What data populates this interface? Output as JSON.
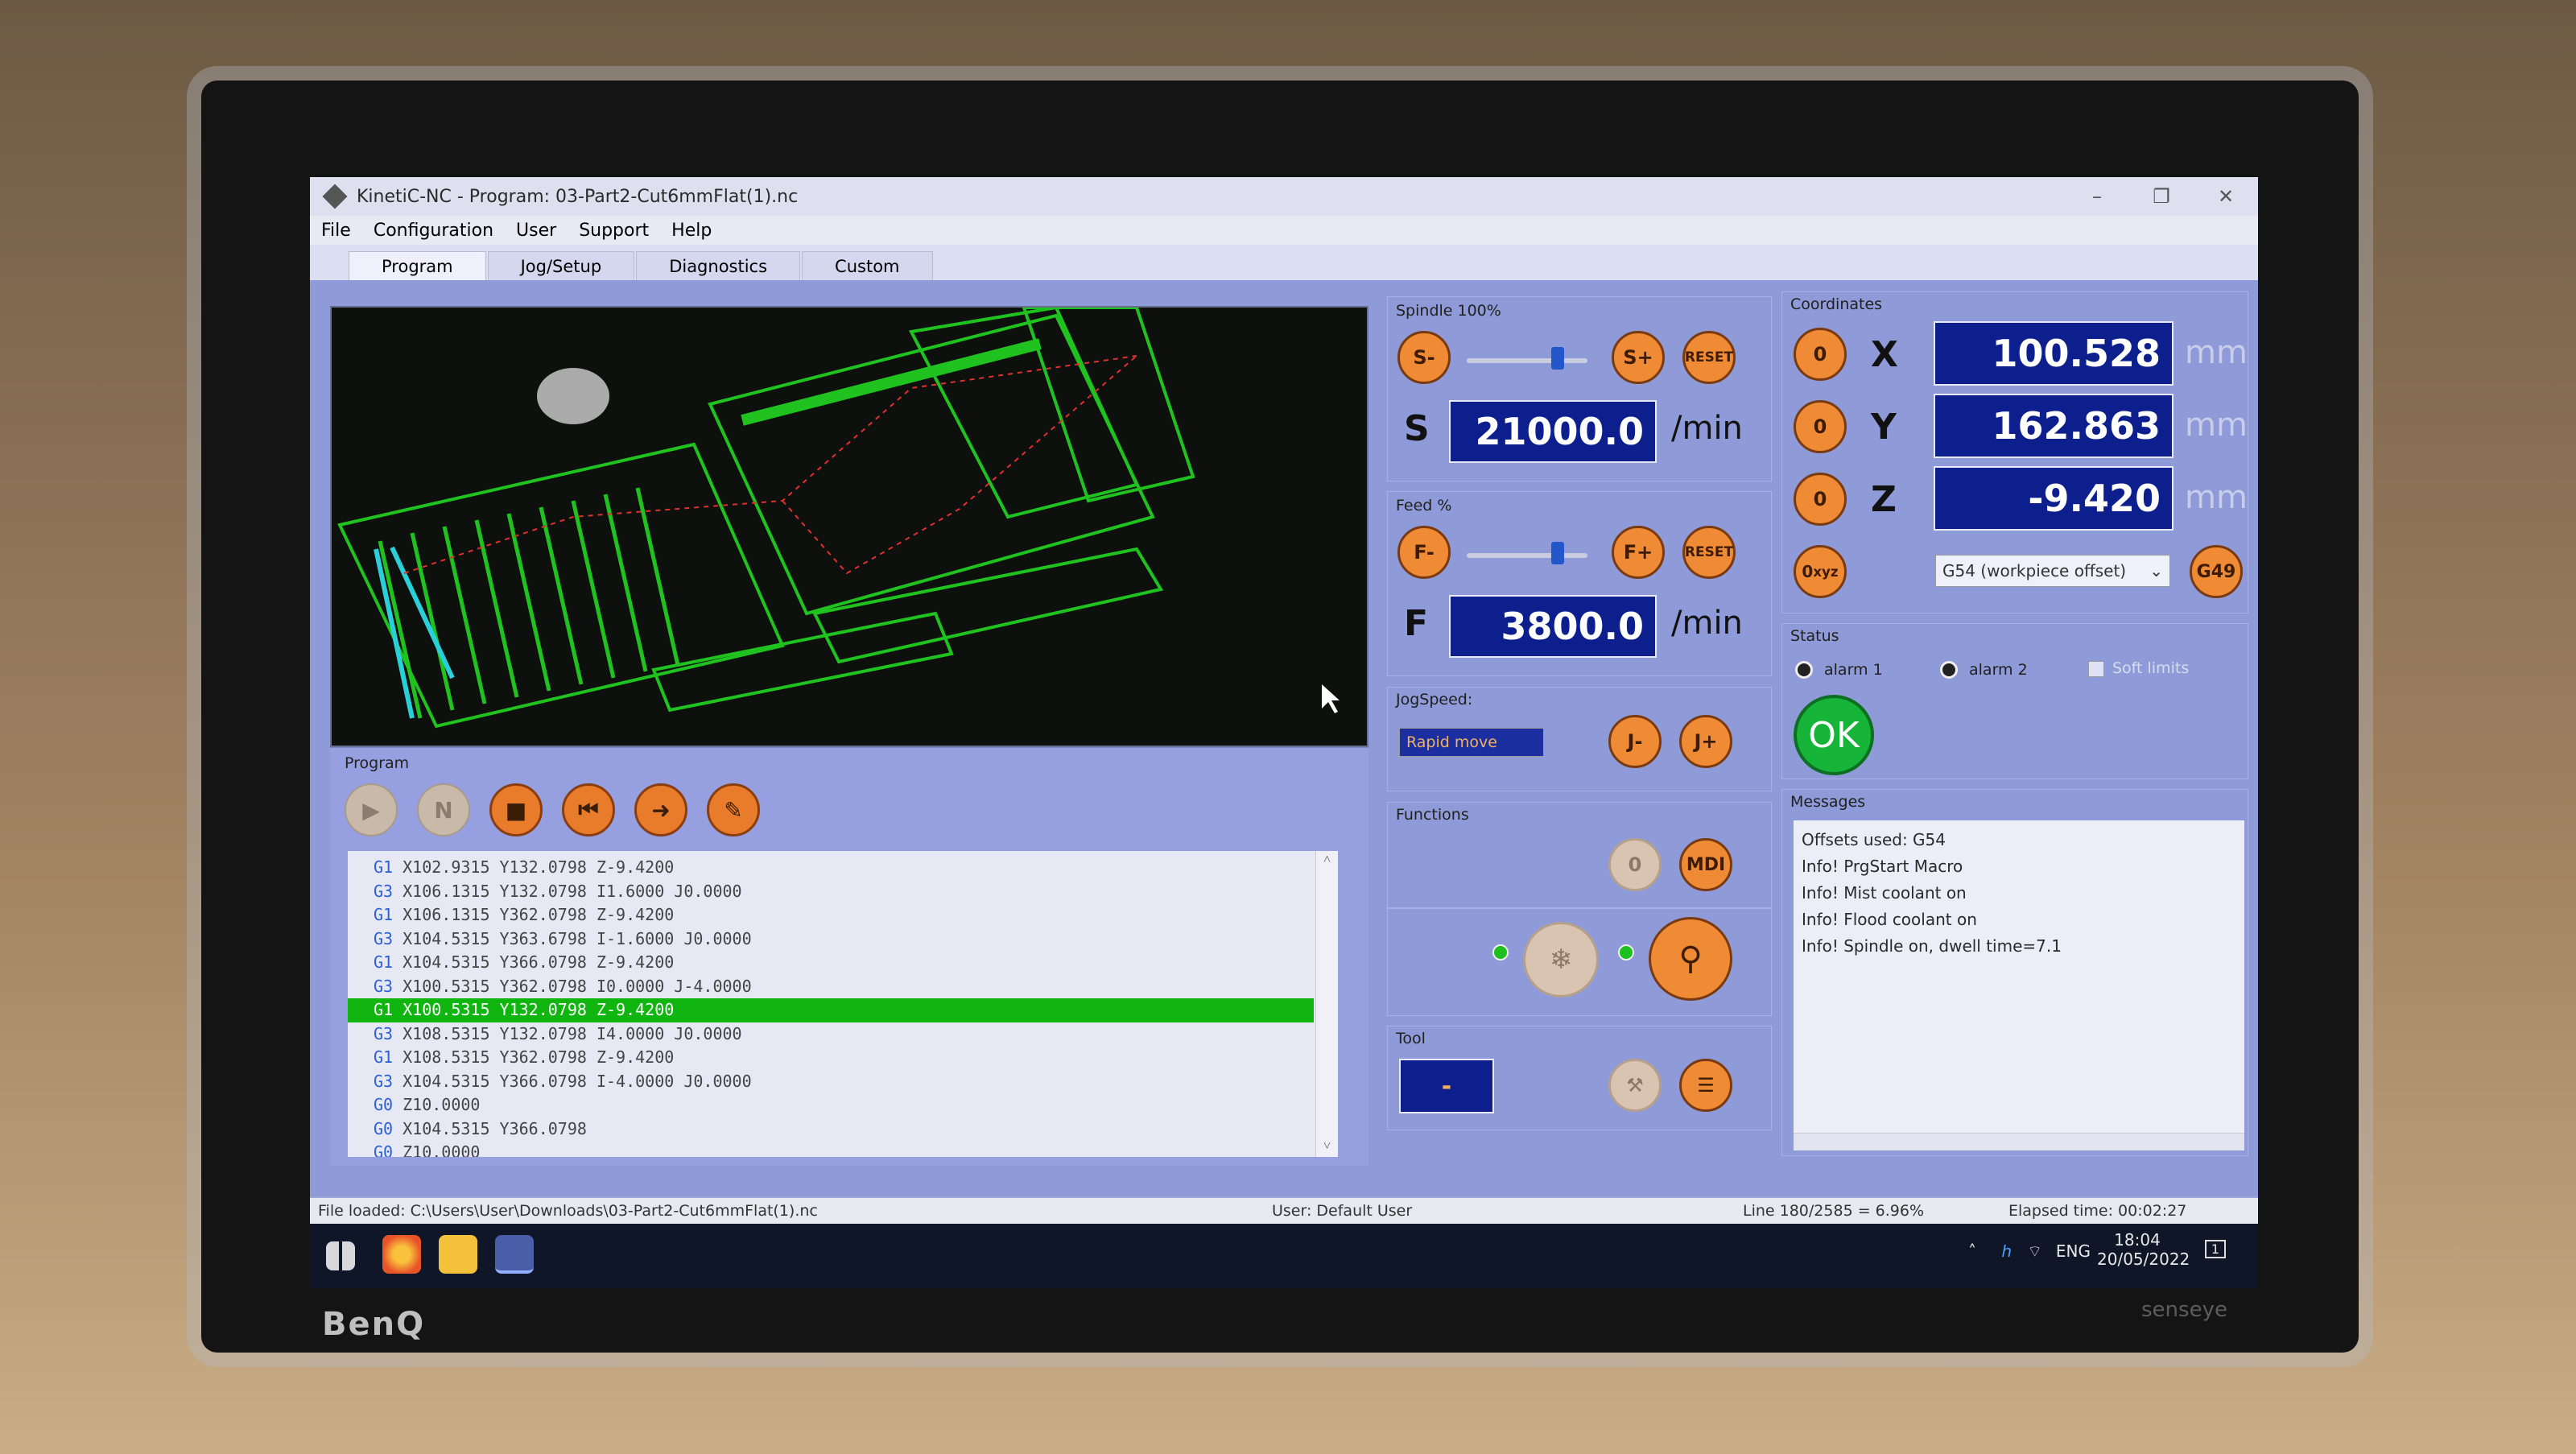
{
  "window": {
    "title": "KinetiC-NC - Program: 03-Part2-Cut6mmFlat(1).nc",
    "controls": [
      "–",
      "❐",
      "✕"
    ]
  },
  "menu": [
    "File",
    "Configuration",
    "User",
    "Support",
    "Help"
  ],
  "tabs": [
    "Program",
    "Jog/Setup",
    "Diagnostics",
    "Custom"
  ],
  "program": {
    "title": "Program",
    "buttons": [
      "▶",
      "N",
      "■",
      "⏮",
      "➜",
      "✎"
    ],
    "lines": [
      {
        "g": "G1",
        "rest": " X102.9315 Y132.0798 Z-9.4200"
      },
      {
        "g": "G3",
        "rest": " X106.1315 Y132.0798 I1.6000 J0.0000"
      },
      {
        "g": "G1",
        "rest": " X106.1315 Y362.0798 Z-9.4200"
      },
      {
        "g": "G3",
        "rest": " X104.5315 Y363.6798 I-1.6000 J0.0000"
      },
      {
        "g": "G1",
        "rest": " X104.5315 Y366.0798 Z-9.4200"
      },
      {
        "g": "G3",
        "rest": " X100.5315 Y362.0798 I0.0000 J-4.0000"
      },
      {
        "g": "G1",
        "rest": " X100.5315 Y132.0798 Z-9.4200"
      },
      {
        "g": "G3",
        "rest": " X108.5315 Y132.0798 I4.0000 J0.0000"
      },
      {
        "g": "G1",
        "rest": " X108.5315 Y362.0798 Z-9.4200"
      },
      {
        "g": "G3",
        "rest": " X104.5315 Y366.0798 I-4.0000 J0.0000"
      },
      {
        "g": "G0",
        "rest": " Z10.0000"
      },
      {
        "g": "G0",
        "rest": " X104.5315 Y366.0798"
      },
      {
        "g": "G0",
        "rest": " Z10.0000"
      }
    ],
    "highlight_index": 6,
    "scroll_up": "˄",
    "scroll_down": "˅"
  },
  "spindle": {
    "title": "Spindle 100%",
    "minus": "S-",
    "plus": "S+",
    "reset": "RESET",
    "letter": "S",
    "value": "21000.0",
    "unit": "/min",
    "override_level": 0.75
  },
  "feed": {
    "title": "Feed %",
    "minus": "F-",
    "plus": "F+",
    "reset": "RESET",
    "letter": "F",
    "value": "3800.0",
    "unit": "/min",
    "override_level": 0.75
  },
  "jog": {
    "title": "JogSpeed:",
    "mode": "Rapid move",
    "minus": "J-",
    "plus": "J+"
  },
  "functions": {
    "title": "Functions",
    "mdi": "MDI",
    "zero": "0"
  },
  "tool": {
    "title": "Tool",
    "value": "-"
  },
  "coordinates": {
    "title": "Coordinates",
    "zero_label": "0",
    "axes": [
      {
        "axis": "X",
        "value": "100.528",
        "unit": "mm"
      },
      {
        "axis": "Y",
        "value": "162.863",
        "unit": "mm"
      },
      {
        "axis": "Z",
        "value": "-9.420",
        "unit": "mm"
      }
    ],
    "offset": "G54 (workpiece offset)",
    "g49": "G49"
  },
  "status": {
    "title": "Status",
    "alarm1": "alarm 1",
    "alarm2": "alarm 2",
    "soft_limits": "Soft limits",
    "ok": "OK"
  },
  "messages": {
    "title": "Messages",
    "items": [
      "Offsets used: G54",
      "Info! PrgStart Macro",
      "Info! Mist coolant on",
      "Info! Flood coolant on",
      "Info! Spindle on, dwell time=7.1"
    ]
  },
  "statusbar": {
    "file": "File loaded: C:\\Users\\User\\Downloads\\03-Part2-Cut6mmFlat(1).nc",
    "user": "User: Default User",
    "line": "Line 180/2585 = 6.96%",
    "elapsed": "Elapsed time: 00:02:27"
  },
  "taskbar": {
    "lang": "ENG",
    "time": "18:04",
    "date": "20/05/2022",
    "notifications": "1"
  },
  "monitor": {
    "brand": "BenQ",
    "sensor": "senseye"
  },
  "colors": {
    "accent": "#ef8a35",
    "readout": "#0c1f8c",
    "ok": "#17b43a",
    "highlight": "#10b510",
    "toolpath": "#1fc21f"
  }
}
